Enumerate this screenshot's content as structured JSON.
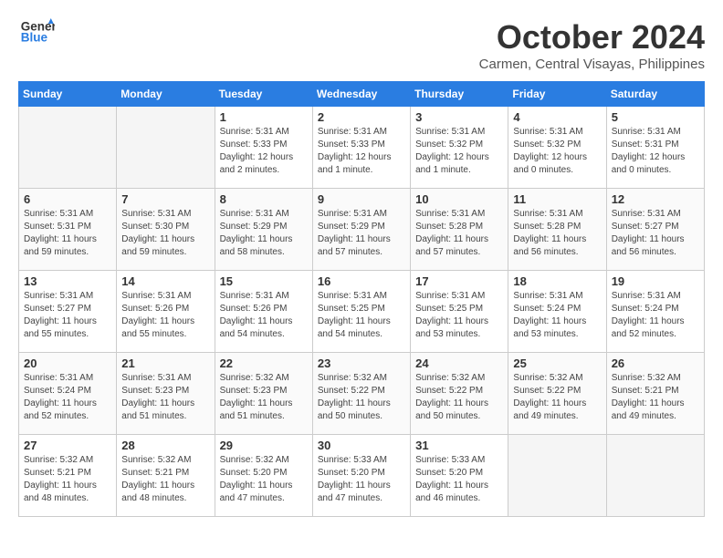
{
  "header": {
    "logo_line1": "General",
    "logo_line2": "Blue",
    "month": "October 2024",
    "location": "Carmen, Central Visayas, Philippines"
  },
  "weekdays": [
    "Sunday",
    "Monday",
    "Tuesday",
    "Wednesday",
    "Thursday",
    "Friday",
    "Saturday"
  ],
  "weeks": [
    [
      {
        "day": "",
        "info": ""
      },
      {
        "day": "",
        "info": ""
      },
      {
        "day": "1",
        "info": "Sunrise: 5:31 AM\nSunset: 5:33 PM\nDaylight: 12 hours\nand 2 minutes."
      },
      {
        "day": "2",
        "info": "Sunrise: 5:31 AM\nSunset: 5:33 PM\nDaylight: 12 hours\nand 1 minute."
      },
      {
        "day": "3",
        "info": "Sunrise: 5:31 AM\nSunset: 5:32 PM\nDaylight: 12 hours\nand 1 minute."
      },
      {
        "day": "4",
        "info": "Sunrise: 5:31 AM\nSunset: 5:32 PM\nDaylight: 12 hours\nand 0 minutes."
      },
      {
        "day": "5",
        "info": "Sunrise: 5:31 AM\nSunset: 5:31 PM\nDaylight: 12 hours\nand 0 minutes."
      }
    ],
    [
      {
        "day": "6",
        "info": "Sunrise: 5:31 AM\nSunset: 5:31 PM\nDaylight: 11 hours\nand 59 minutes."
      },
      {
        "day": "7",
        "info": "Sunrise: 5:31 AM\nSunset: 5:30 PM\nDaylight: 11 hours\nand 59 minutes."
      },
      {
        "day": "8",
        "info": "Sunrise: 5:31 AM\nSunset: 5:29 PM\nDaylight: 11 hours\nand 58 minutes."
      },
      {
        "day": "9",
        "info": "Sunrise: 5:31 AM\nSunset: 5:29 PM\nDaylight: 11 hours\nand 57 minutes."
      },
      {
        "day": "10",
        "info": "Sunrise: 5:31 AM\nSunset: 5:28 PM\nDaylight: 11 hours\nand 57 minutes."
      },
      {
        "day": "11",
        "info": "Sunrise: 5:31 AM\nSunset: 5:28 PM\nDaylight: 11 hours\nand 56 minutes."
      },
      {
        "day": "12",
        "info": "Sunrise: 5:31 AM\nSunset: 5:27 PM\nDaylight: 11 hours\nand 56 minutes."
      }
    ],
    [
      {
        "day": "13",
        "info": "Sunrise: 5:31 AM\nSunset: 5:27 PM\nDaylight: 11 hours\nand 55 minutes."
      },
      {
        "day": "14",
        "info": "Sunrise: 5:31 AM\nSunset: 5:26 PM\nDaylight: 11 hours\nand 55 minutes."
      },
      {
        "day": "15",
        "info": "Sunrise: 5:31 AM\nSunset: 5:26 PM\nDaylight: 11 hours\nand 54 minutes."
      },
      {
        "day": "16",
        "info": "Sunrise: 5:31 AM\nSunset: 5:25 PM\nDaylight: 11 hours\nand 54 minutes."
      },
      {
        "day": "17",
        "info": "Sunrise: 5:31 AM\nSunset: 5:25 PM\nDaylight: 11 hours\nand 53 minutes."
      },
      {
        "day": "18",
        "info": "Sunrise: 5:31 AM\nSunset: 5:24 PM\nDaylight: 11 hours\nand 53 minutes."
      },
      {
        "day": "19",
        "info": "Sunrise: 5:31 AM\nSunset: 5:24 PM\nDaylight: 11 hours\nand 52 minutes."
      }
    ],
    [
      {
        "day": "20",
        "info": "Sunrise: 5:31 AM\nSunset: 5:24 PM\nDaylight: 11 hours\nand 52 minutes."
      },
      {
        "day": "21",
        "info": "Sunrise: 5:31 AM\nSunset: 5:23 PM\nDaylight: 11 hours\nand 51 minutes."
      },
      {
        "day": "22",
        "info": "Sunrise: 5:32 AM\nSunset: 5:23 PM\nDaylight: 11 hours\nand 51 minutes."
      },
      {
        "day": "23",
        "info": "Sunrise: 5:32 AM\nSunset: 5:22 PM\nDaylight: 11 hours\nand 50 minutes."
      },
      {
        "day": "24",
        "info": "Sunrise: 5:32 AM\nSunset: 5:22 PM\nDaylight: 11 hours\nand 50 minutes."
      },
      {
        "day": "25",
        "info": "Sunrise: 5:32 AM\nSunset: 5:22 PM\nDaylight: 11 hours\nand 49 minutes."
      },
      {
        "day": "26",
        "info": "Sunrise: 5:32 AM\nSunset: 5:21 PM\nDaylight: 11 hours\nand 49 minutes."
      }
    ],
    [
      {
        "day": "27",
        "info": "Sunrise: 5:32 AM\nSunset: 5:21 PM\nDaylight: 11 hours\nand 48 minutes."
      },
      {
        "day": "28",
        "info": "Sunrise: 5:32 AM\nSunset: 5:21 PM\nDaylight: 11 hours\nand 48 minutes."
      },
      {
        "day": "29",
        "info": "Sunrise: 5:32 AM\nSunset: 5:20 PM\nDaylight: 11 hours\nand 47 minutes."
      },
      {
        "day": "30",
        "info": "Sunrise: 5:33 AM\nSunset: 5:20 PM\nDaylight: 11 hours\nand 47 minutes."
      },
      {
        "day": "31",
        "info": "Sunrise: 5:33 AM\nSunset: 5:20 PM\nDaylight: 11 hours\nand 46 minutes."
      },
      {
        "day": "",
        "info": ""
      },
      {
        "day": "",
        "info": ""
      }
    ]
  ]
}
